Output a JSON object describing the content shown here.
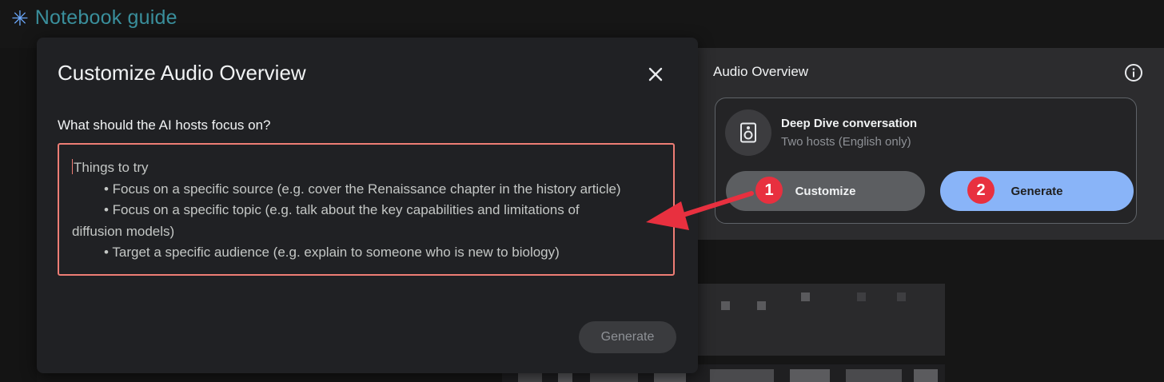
{
  "header": {
    "title": "Notebook guide"
  },
  "audio_panel": {
    "title": "Audio Overview",
    "card": {
      "title": "Deep Dive conversation",
      "subtitle": "Two hosts (English only)",
      "customize_label": "Customize",
      "generate_label": "Generate"
    },
    "badges": [
      "1",
      "2"
    ]
  },
  "modal": {
    "title": "Customize Audio Overview",
    "question": "What should the AI hosts focus on?",
    "placeholder": {
      "heading": "Things to try",
      "items": [
        "• Focus on a specific source (e.g. cover the Renaissance chapter in the history article)",
        "• Focus on a specific topic (e.g. talk about the key capabilities and limitations of",
        "diffusion models)",
        "• Target a specific audience (e.g. explain to someone who is new to biology)"
      ]
    },
    "generate_label": "Generate"
  },
  "colors": {
    "accent_blue": "#89b4f8",
    "annotation_red": "#e8303f",
    "focus_border": "#ee7d75"
  }
}
